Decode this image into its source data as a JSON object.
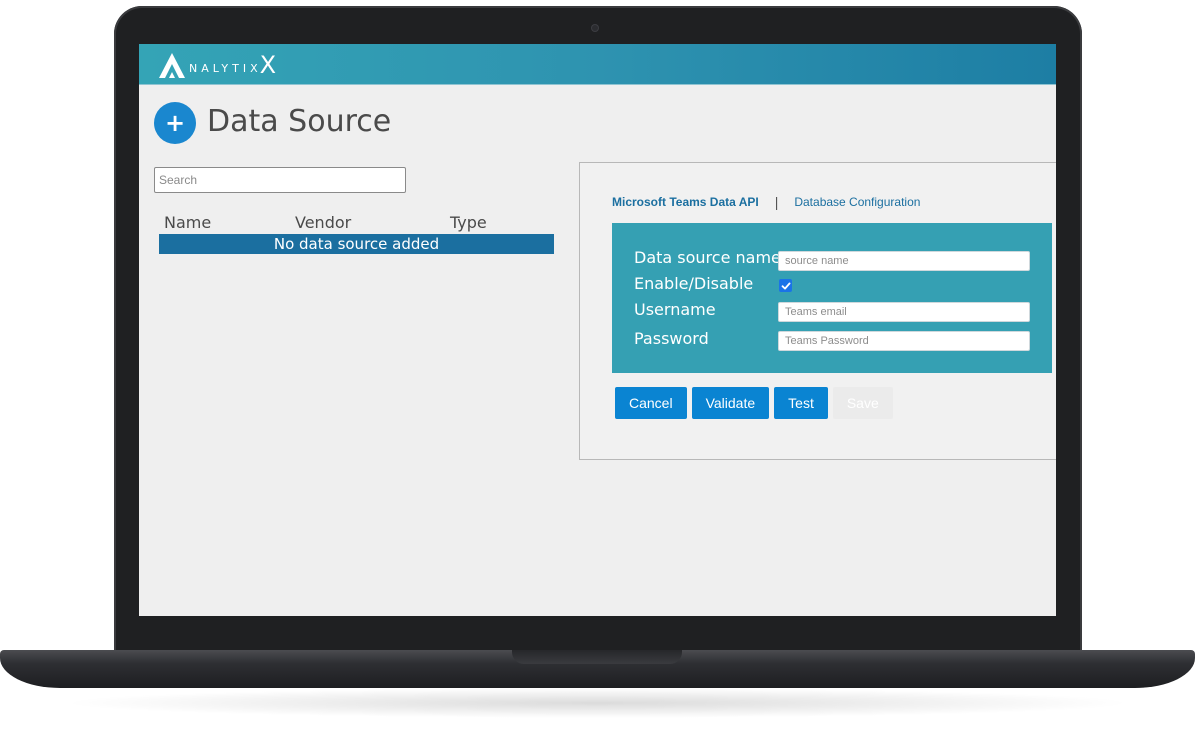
{
  "app": {
    "logo_text": "NALYTIX",
    "logo_x": "X"
  },
  "page": {
    "add_symbol": "+",
    "title": "Data Source"
  },
  "datasource_list": {
    "search_placeholder": "Search",
    "columns": [
      "Name",
      "Vendor",
      "Type"
    ],
    "empty_message": "No data source added"
  },
  "config_panel": {
    "tabs": [
      {
        "label": "Microsoft Teams Data API",
        "active": true
      },
      {
        "label": "Database Configuration",
        "active": false
      }
    ],
    "tab_separator": "|",
    "form": {
      "source_name_label": "Data source name",
      "source_name_placeholder": "source name",
      "enable_label": "Enable/Disable",
      "enabled": true,
      "username_label": "Username",
      "username_placeholder": "Teams email",
      "password_label": "Password",
      "password_placeholder": "Teams Password"
    },
    "buttons": {
      "cancel": "Cancel",
      "validate": "Validate",
      "test": "Test",
      "save": "Save"
    }
  },
  "colors": {
    "header_start": "#34a4b6",
    "header_end": "#1d7ea4",
    "accent_blue": "#0a84d2",
    "row_blue": "#1b6fa0",
    "form_teal": "#35a0b3"
  }
}
